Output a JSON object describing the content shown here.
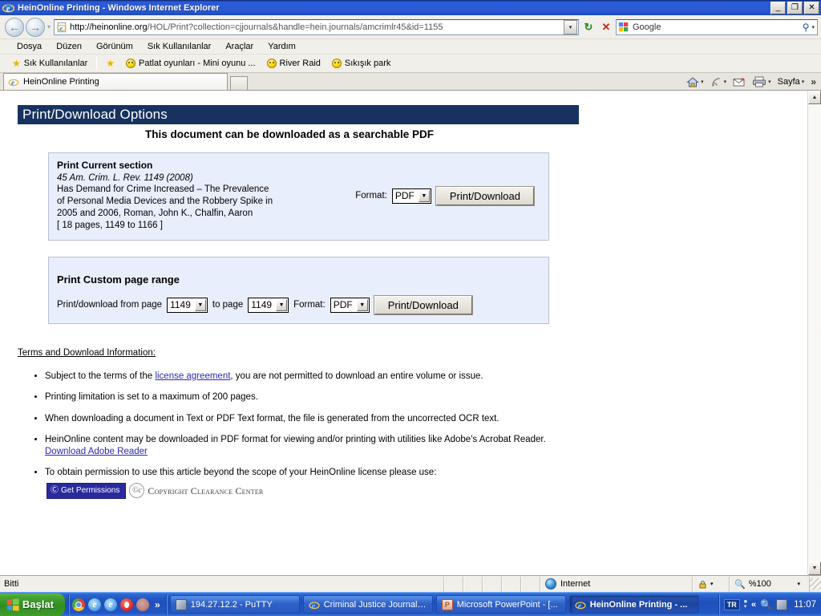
{
  "window": {
    "title": "HeinOnline Printing - Windows Internet Explorer",
    "minimize_label": "_",
    "maximize_label": "❐",
    "close_label": "✕"
  },
  "browser": {
    "back_label": "←",
    "forward_label": "→",
    "history_caret": "▾",
    "url_domain": "http://heinonline.org",
    "url_path": "/HOL/Print?collection=cjjournals&handle=hein.journals/amcrimlr45&id=1155",
    "url_dropdown_caret": "▾",
    "refresh_label": "↻",
    "stop_label": "✕",
    "search_value": "Google",
    "search_go_label": "⚲",
    "search_caret": "▾",
    "menu": [
      "Dosya",
      "Düzen",
      "Görünüm",
      "Sık Kullanılanlar",
      "Araçlar",
      "Yardım"
    ],
    "favorites_button": "Sık Kullanılanlar",
    "favorites": [
      "Patlat oyunları - Mini oyunu ...",
      "River Raid",
      "Sıkışık park"
    ],
    "tab_title": "HeinOnline Printing",
    "newtab_label": "",
    "commandbar": {
      "home": "home-icon",
      "feeds": "feeds-icon",
      "mail": "mail-icon",
      "print": "print-icon",
      "page_label": "Sayfa",
      "caret": "▾",
      "overflow": "»"
    }
  },
  "content": {
    "header_title": "Print/Download Options",
    "subtitle": "This document can be downloaded as a searchable PDF",
    "current_section": {
      "heading": "Print Current section",
      "citation": "45 Am. Crim. L. Rev. 1149 (2008)",
      "title_lines": [
        "Has Demand for Crime Increased – The Prevalence",
        "of Personal Media Devices and the Robbery Spike in",
        "2005 and 2006, Roman, John K., Chalfin, Aaron"
      ],
      "pages": "[ 18 pages, 1149 to 1166 ]",
      "format_label": "Format:",
      "format_value": "PDF",
      "button_label": "Print/Download"
    },
    "custom_range": {
      "heading": "Print Custom page range",
      "from_label": "Print/download from page",
      "from_value": "1149",
      "to_label": "to page",
      "to_value": "1149",
      "format_label": "Format:",
      "format_value": "PDF",
      "button_label": "Print/Download"
    },
    "terms_heading": "Terms and Download Information:",
    "terms": [
      {
        "before": "Subject to the terms of the ",
        "link": "license agreement",
        "after": ", you are not permitted to download an entire volume or issue."
      },
      {
        "before": "Printing limitation is set to a maximum of 200 pages.",
        "link": "",
        "after": ""
      },
      {
        "before": "When downloading a document in Text or PDF Text format, the file is generated from the uncorrected OCR text.",
        "link": "",
        "after": ""
      },
      {
        "before": "HeinOnline content may be downloaded in PDF format for viewing and/or printing with utilities like Adobe's Acrobat Reader. ",
        "link": "Download Adobe Reader",
        "after": ""
      },
      {
        "before": "To obtain permission to use this article beyond the scope of your HeinOnline license please use:",
        "link": "",
        "after": ""
      }
    ],
    "permissions_button": "Get Permissions",
    "permissions_button_mark": "Ⓒ",
    "ccc_mark": "ⒸⒸ",
    "ccc_name": "Copyright Clearance Center"
  },
  "scrollbar": {
    "up": "▲",
    "down": "▼"
  },
  "statusbar": {
    "message": "Bitti",
    "zone": "Internet",
    "zoom": "%100",
    "zoom_caret": "▾",
    "lock_caret": "▾"
  },
  "taskbar": {
    "start_label": "Başlat",
    "quicklaunch_overflow": "»",
    "items": [
      {
        "label": "194.27.12.2 - PuTTY",
        "icon": "putty-icon",
        "active": false
      },
      {
        "label": "Criminal Justice Journals...",
        "icon": "ie-icon",
        "active": false
      },
      {
        "label": "Microsoft PowerPoint - [...",
        "icon": "powerpoint-icon",
        "active": false
      },
      {
        "label": "HeinOnline Printing - ...",
        "icon": "ie-icon",
        "active": true
      }
    ],
    "tray": {
      "language": "TR",
      "overflow": "«",
      "clock": "11:07"
    }
  },
  "colors": {
    "header_navy": "#17325f",
    "panel_blue": "#e9eefc",
    "link_blue": "#2a2ab0",
    "titlebar_blue": "#2a5ad8"
  }
}
